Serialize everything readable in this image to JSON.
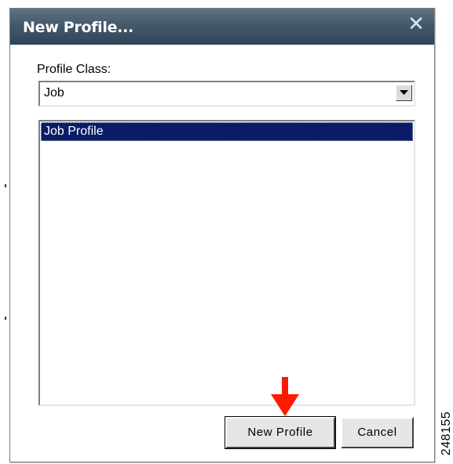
{
  "dialog": {
    "title": "New Profile...",
    "close_icon": "close-icon",
    "close_glyph": "✕"
  },
  "profile_class": {
    "label": "Profile Class:",
    "selected_value": "Job",
    "dropdown_icon": "chevron-down-icon"
  },
  "profile_list": {
    "items": [
      {
        "label": "Job Profile",
        "selected": true
      }
    ]
  },
  "buttons": {
    "new_profile": "New Profile",
    "cancel": "Cancel"
  },
  "annotation": {
    "arrow_icon": "red-down-arrow-icon",
    "arrow_color": "#ff1a00"
  },
  "figure_id": "248155",
  "colors": {
    "titlebar": "#44596b",
    "selection": "#0b1c66"
  }
}
